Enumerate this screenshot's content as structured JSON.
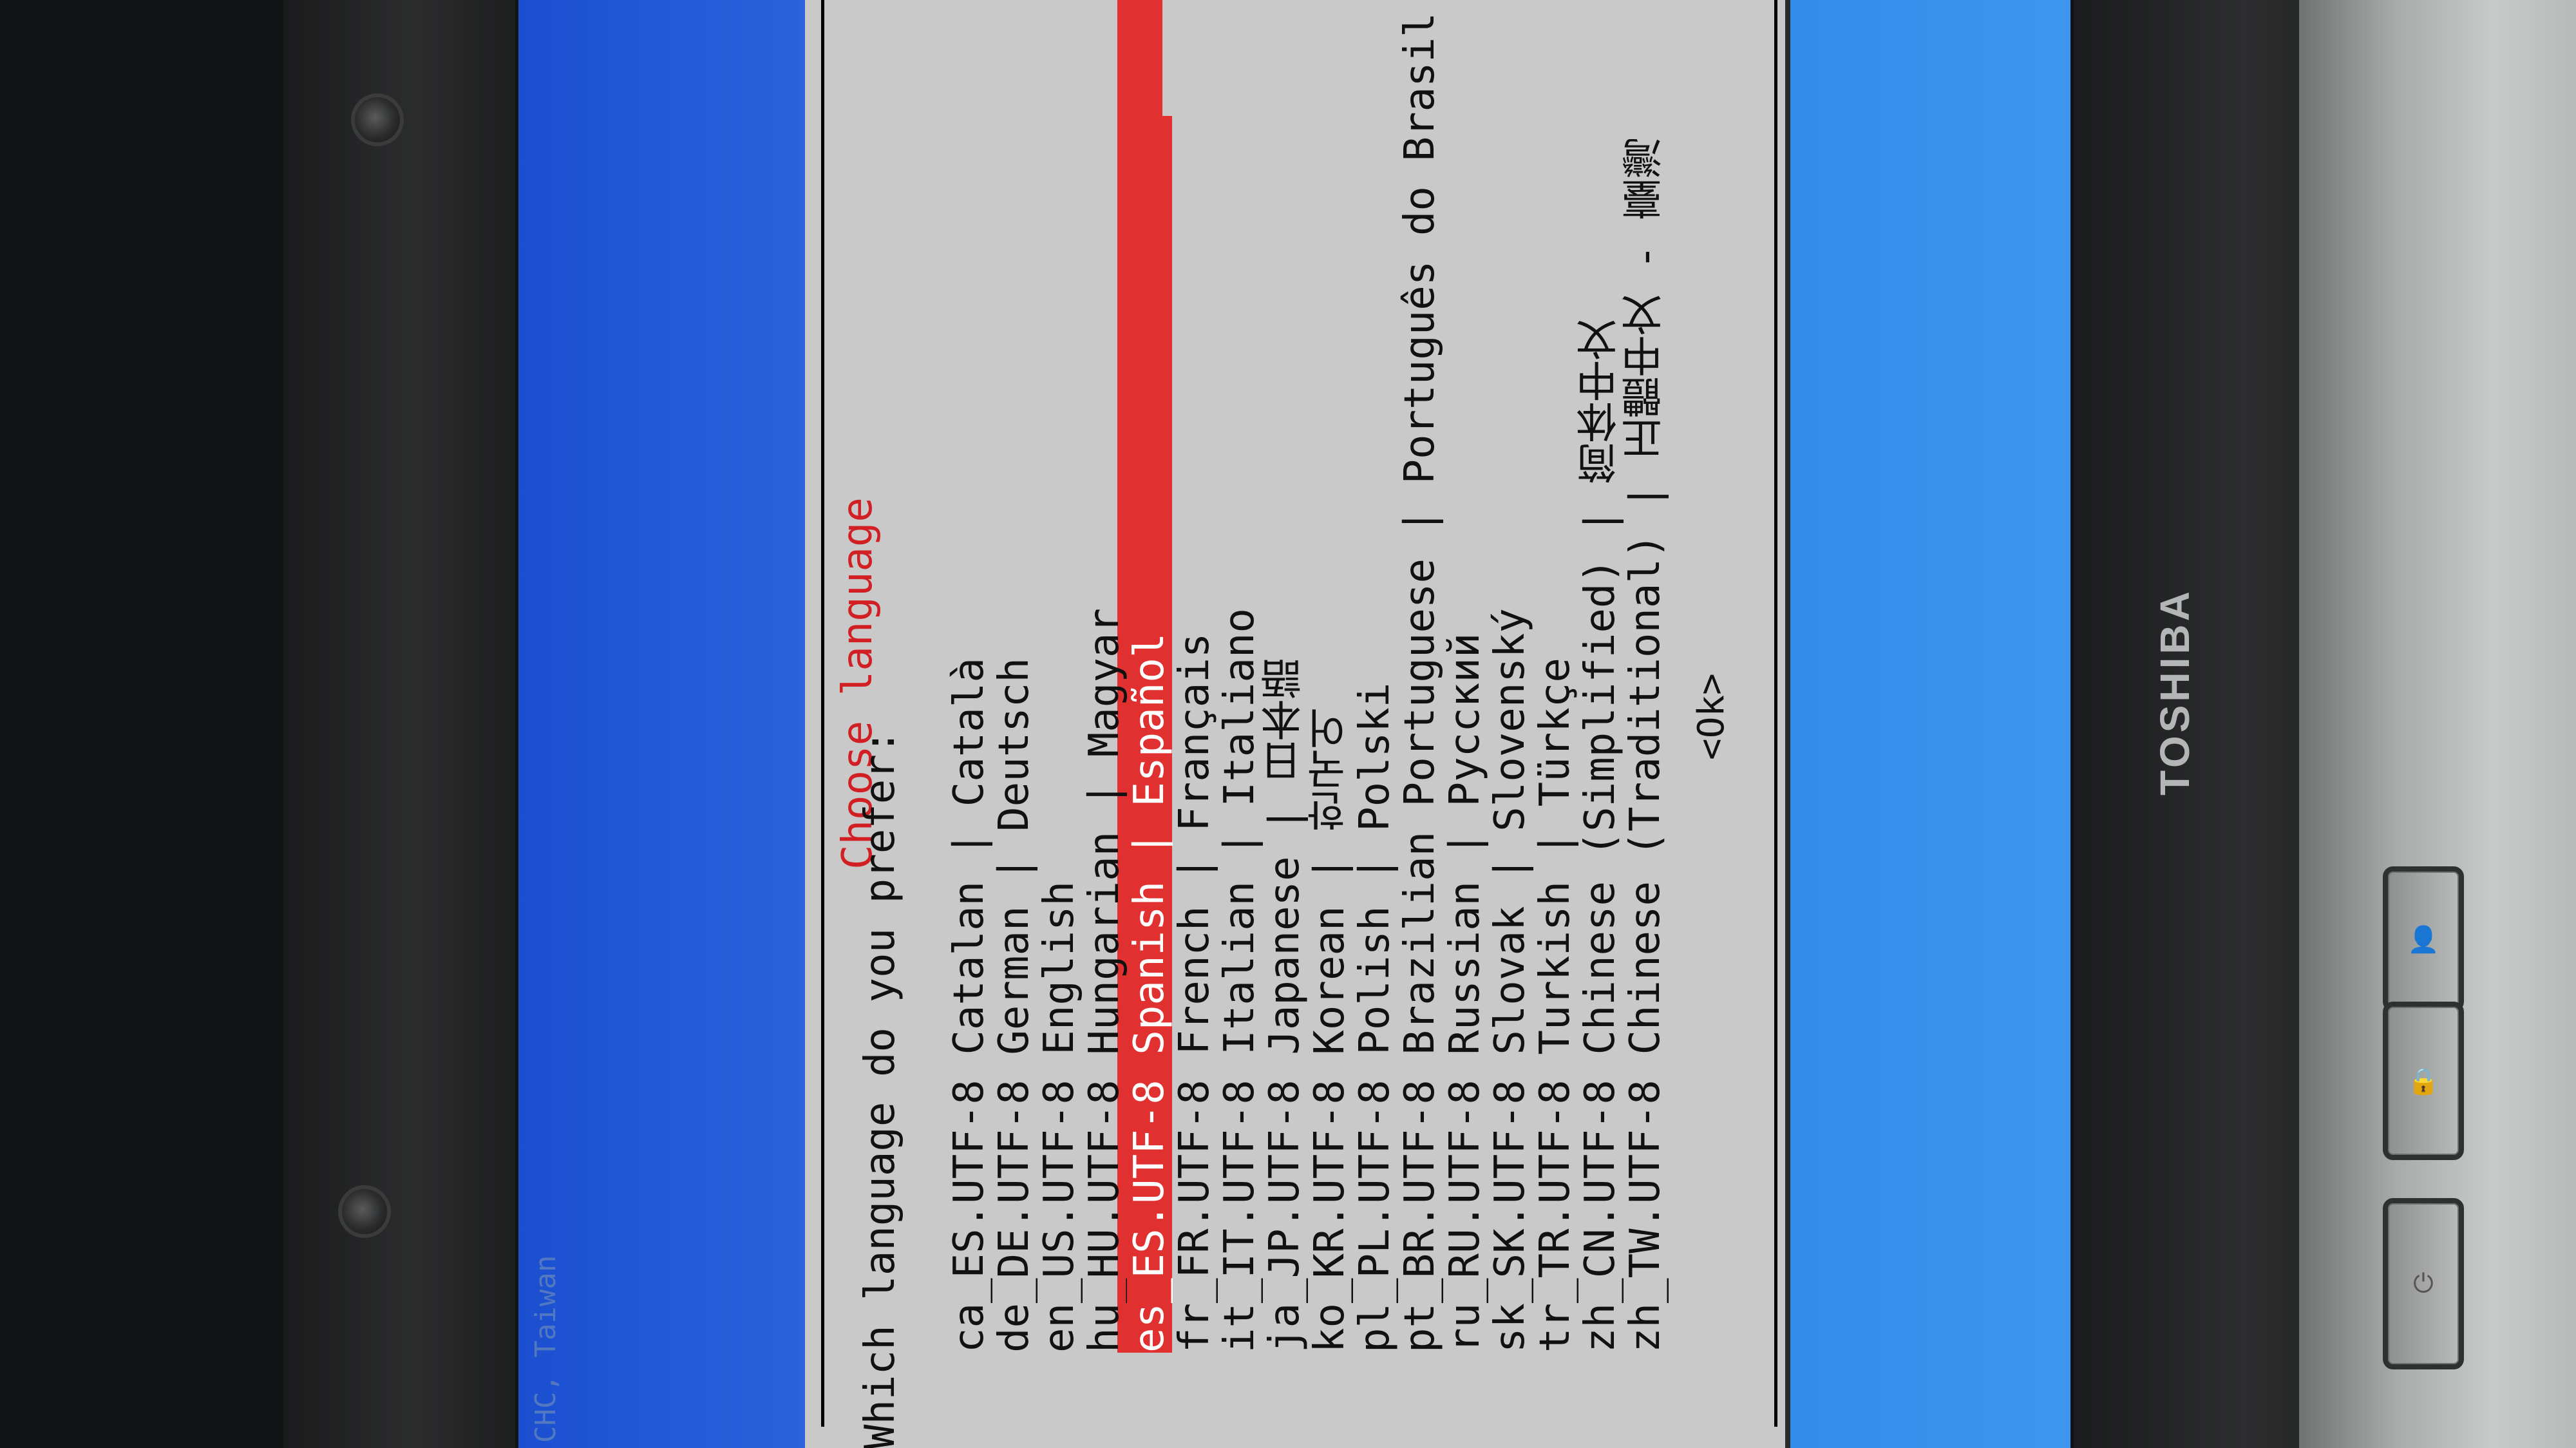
{
  "device": {
    "brand": "TOSHIBA"
  },
  "screen": {
    "footer_text": "CHC, Taiwan"
  },
  "installer": {
    "title": "Choose language",
    "prompt": "Which language do you prefer:",
    "options": [
      "ca_ES.UTF-8 Catalan | Català",
      "de_DE.UTF-8 German | Deutsch",
      "en_US.UTF-8 English",
      "hu_HU.UTF-8 Hungarian | Magyar",
      "es_ES.UTF-8 Spanish | Español",
      "fr_FR.UTF-8 French | Français",
      "it_IT.UTF-8 Italian | Italiano",
      "ja_JP.UTF-8 Japanese | 日本語",
      "ko_KR.UTF-8 Korean | 한국어",
      "pl_PL.UTF-8 Polish | Polski",
      "pt_BR.UTF-8 Brazilian Portuguese | Português do Brasil",
      "ru_RU.UTF-8 Russian | Русский",
      "sk_SK.UTF-8 Slovak | Slovenský",
      "tr_TR.UTF-8 Turkish | Türkçe",
      "zh_CN.UTF-8 Chinese (Simplified) | 简体中文",
      "zh_TW.UTF-8 Chinese (Traditional) | 正體中文 - 臺灣"
    ],
    "selected_index": 4,
    "ok_label": "<Ok>"
  },
  "colors": {
    "title": "#d21f24",
    "selection_bg": "#e03030",
    "screen_bg": "#2f6ae0",
    "dialog_bg": "#c9c9c9"
  },
  "icons": {
    "button_a": "person-icon",
    "button_b": "lock-icon",
    "button_c": "power-icon"
  }
}
